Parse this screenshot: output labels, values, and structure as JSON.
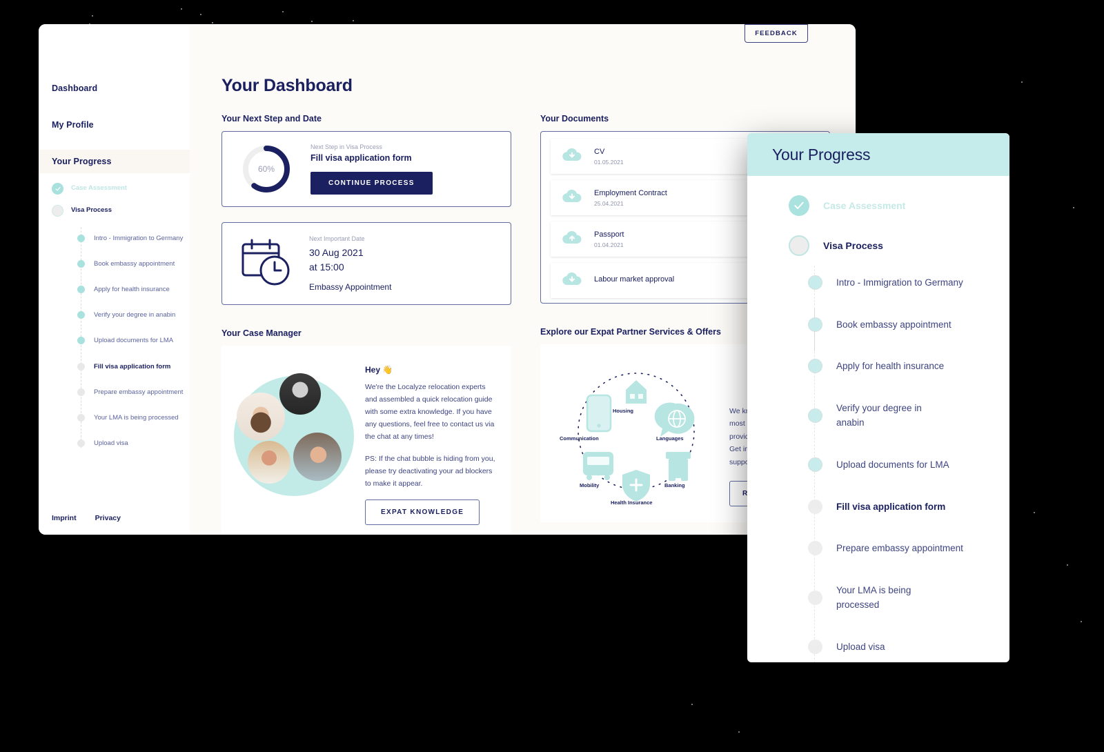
{
  "sidebar": {
    "nav": [
      {
        "label": "Dashboard"
      },
      {
        "label": "My Profile"
      },
      {
        "label": "Your Progress"
      }
    ],
    "tree": [
      {
        "label": "Case Assessment",
        "state": "done"
      },
      {
        "label": "Visa Process",
        "state": "current"
      }
    ],
    "substeps": [
      {
        "label": "Intro - Immigration to Germany",
        "state": "done"
      },
      {
        "label": "Book embassy appointment",
        "state": "done"
      },
      {
        "label": "Apply for health insurance",
        "state": "done"
      },
      {
        "label": "Verify your degree in anabin",
        "state": "done"
      },
      {
        "label": "Upload documents for LMA",
        "state": "done"
      },
      {
        "label": "Fill visa application form",
        "state": "current"
      },
      {
        "label": "Prepare embassy appointment",
        "state": "todo"
      },
      {
        "label": "Your LMA is being processed",
        "state": "todo"
      },
      {
        "label": "Upload visa",
        "state": "todo"
      }
    ],
    "footer": [
      {
        "label": "Imprint"
      },
      {
        "label": "Privacy"
      }
    ]
  },
  "header": {
    "feedback_label": "FEEDBACK",
    "page_title": "Your Dashboard"
  },
  "next_step": {
    "section_title": "Your Next Step and Date",
    "progress_percent": "60%",
    "progress_value": 60,
    "kicker": "Next Step in Visa Process",
    "title": "Fill visa application form",
    "button_label": "CONTINUE PROCESS"
  },
  "next_date": {
    "kicker": "Next Important Date",
    "date_line1": "30 Aug 2021",
    "date_line2": "at 15:00",
    "subject": "Embassy Appointment"
  },
  "documents": {
    "section_title": "Your Documents",
    "items": [
      {
        "name": "CV",
        "date": "01.05.2021",
        "icon": "cloud-download-icon"
      },
      {
        "name": "Employment Contract",
        "date": "25.04.2021",
        "icon": "cloud-download-icon"
      },
      {
        "name": "Passport",
        "date": "01.04.2021",
        "icon": "cloud-upload-icon"
      },
      {
        "name": "Labour market approval",
        "date": "",
        "icon": "cloud-download-icon"
      }
    ]
  },
  "case_manager": {
    "section_title": "Your Case Manager",
    "hey": "Hey 👋",
    "paragraph1": "We're the Localyze relocation experts and assembled a quick relocation guide with some extra knowledge. If you have any questions, feel free to contact us via the chat at any times!",
    "paragraph2": "PS: If the chat bubble is hiding from you, please try deactivating your ad blockers to make it appear.",
    "button_label": "EXPAT KNOWLEDGE"
  },
  "partners": {
    "section_title": "Explore our Expat Partner Services & Offers",
    "wheel": [
      {
        "label": "Housing",
        "icon": "house-icon"
      },
      {
        "label": "Languages",
        "icon": "globe-speech-icon"
      },
      {
        "label": "Banking",
        "icon": "bank-icon"
      },
      {
        "label": "Health Insurance",
        "icon": "shield-plus-icon"
      },
      {
        "label": "Mobility",
        "icon": "bus-icon"
      },
      {
        "label": "Communication",
        "icon": "phone-icon"
      }
    ],
    "paragraph": "We know ar\nmost expat\nproviders i\nGet in touc\nsupport!",
    "button_label": "REQU"
  },
  "progress_panel": {
    "title": "Your Progress",
    "stages": [
      {
        "label": "Case Assessment",
        "state": "done"
      },
      {
        "label": "Visa Process",
        "state": "current"
      }
    ],
    "steps": [
      {
        "label": "Intro - Immigration to Germany",
        "state": "done"
      },
      {
        "label": "Book embassy appointment",
        "state": "done"
      },
      {
        "label": "Apply for health insurance",
        "state": "done"
      },
      {
        "label": "Verify your degree in anabin",
        "state": "done"
      },
      {
        "label": "Upload documents for LMA",
        "state": "done"
      },
      {
        "label": "Fill visa application form",
        "state": "current"
      },
      {
        "label": "Prepare embassy appointment",
        "state": "todo"
      },
      {
        "label": "Your LMA is being processed",
        "state": "todo"
      },
      {
        "label": "Upload visa",
        "state": "todo"
      }
    ]
  },
  "colors": {
    "navy": "#1b2060",
    "teal": "#a8e1de",
    "teal_header": "#c5ecea",
    "cream": "#fdfbf7",
    "grey_dot": "#ededed"
  }
}
